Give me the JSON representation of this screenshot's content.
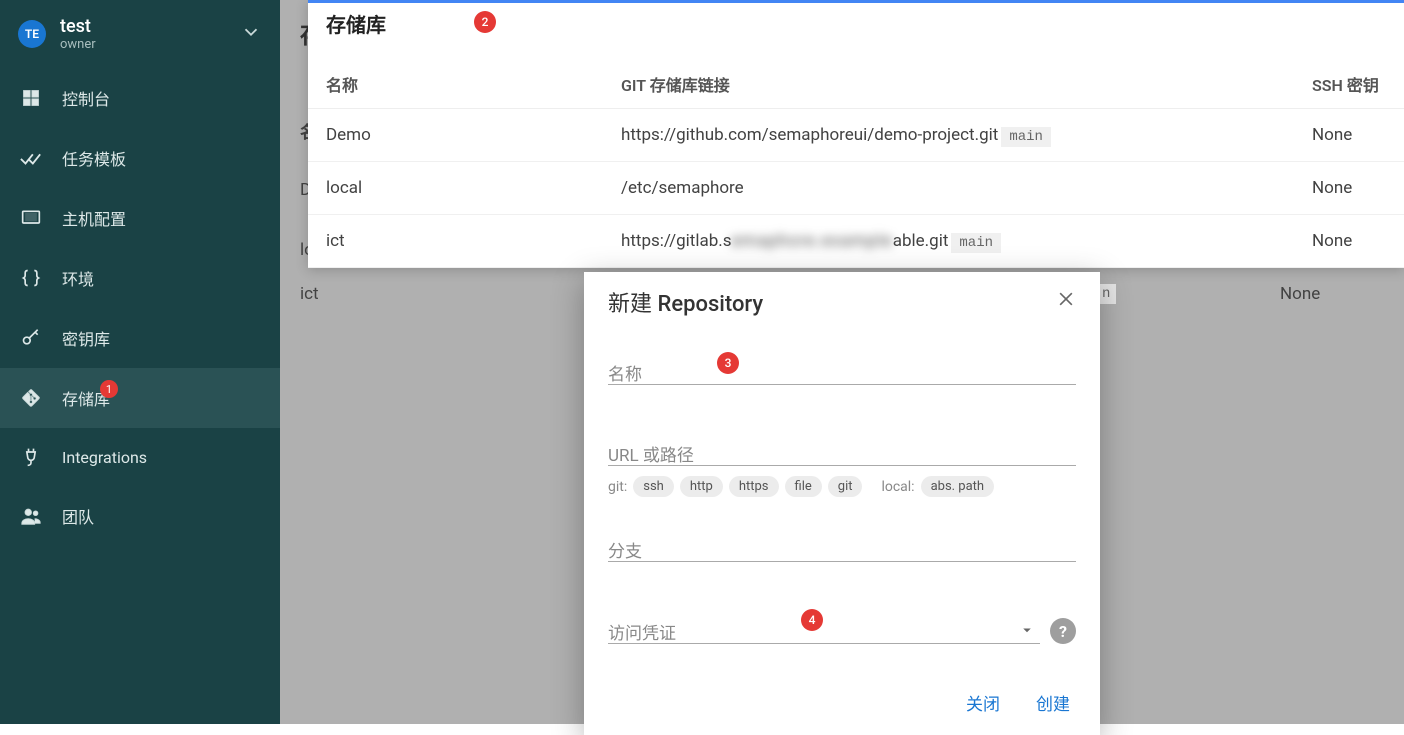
{
  "sidebar": {
    "avatar": "TE",
    "project_name": "test",
    "project_role": "owner",
    "items": [
      {
        "label": "控制台"
      },
      {
        "label": "任务模板"
      },
      {
        "label": "主机配置"
      },
      {
        "label": "环境"
      },
      {
        "label": "密钥库"
      },
      {
        "label": "存储库",
        "badge": "1"
      },
      {
        "label": "Integrations"
      },
      {
        "label": "团队"
      }
    ]
  },
  "bg": {
    "row1_name": "ict",
    "row1_branch": "n",
    "row1_ssh": "None"
  },
  "popup": {
    "title": "存储库",
    "headers": {
      "name": "名称",
      "link": "GIT 存储库链接",
      "ssh": "SSH 密钥"
    },
    "rows": [
      {
        "name": "Demo",
        "link": "https://github.com/semaphoreui/demo-project.git",
        "branch": "main",
        "ssh": "None"
      },
      {
        "name": "local",
        "link": "/etc/semaphore",
        "branch": "",
        "ssh": "None"
      },
      {
        "name": "ict",
        "link_pre": "https://gitlab.s",
        "link_blur": "emaphore.example",
        "link_post": "able.git",
        "branch": "main",
        "ssh": "None"
      }
    ]
  },
  "dialog": {
    "title": "新建 Repository",
    "fields": {
      "name_label": "名称",
      "url_label": "URL 或路径",
      "branch_label": "分支",
      "cred_label": "访问凭证"
    },
    "hints": {
      "git_label": "git:",
      "local_label": "local:",
      "tags": [
        "ssh",
        "http",
        "https",
        "file",
        "git"
      ],
      "local_tag": "abs. path"
    },
    "actions": {
      "close": "关闭",
      "create": "创建"
    }
  },
  "markers": {
    "m2": "2",
    "m3": "3",
    "m4": "4"
  }
}
